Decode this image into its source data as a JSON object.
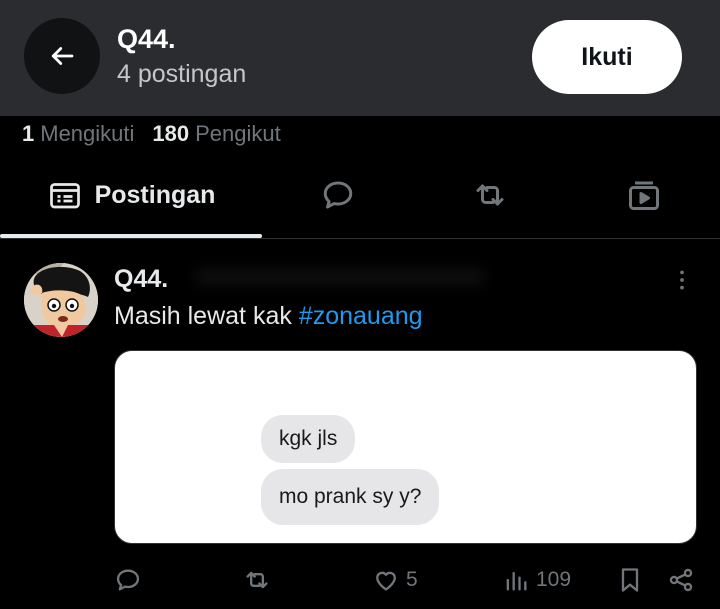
{
  "header": {
    "title": "Q44.",
    "subtitle": "4 postingan",
    "follow_label": "Ikuti"
  },
  "stats": {
    "following_count": "1",
    "following_label": "Mengikuti",
    "followers_count": "180",
    "followers_label": "Pengikut"
  },
  "tabs": {
    "posts_label": "Postingan",
    "active": "posts"
  },
  "post": {
    "author": "Q44.",
    "text": "Masih lewat kak",
    "hashtag": "#zonauang",
    "image_messages": [
      "kgk jls",
      "mo prank sy y?"
    ],
    "likes": "5",
    "views": "109"
  },
  "colors": {
    "header_bg": "#2a2c2f",
    "accent": "#1d9bf0",
    "muted": "#71767b"
  }
}
